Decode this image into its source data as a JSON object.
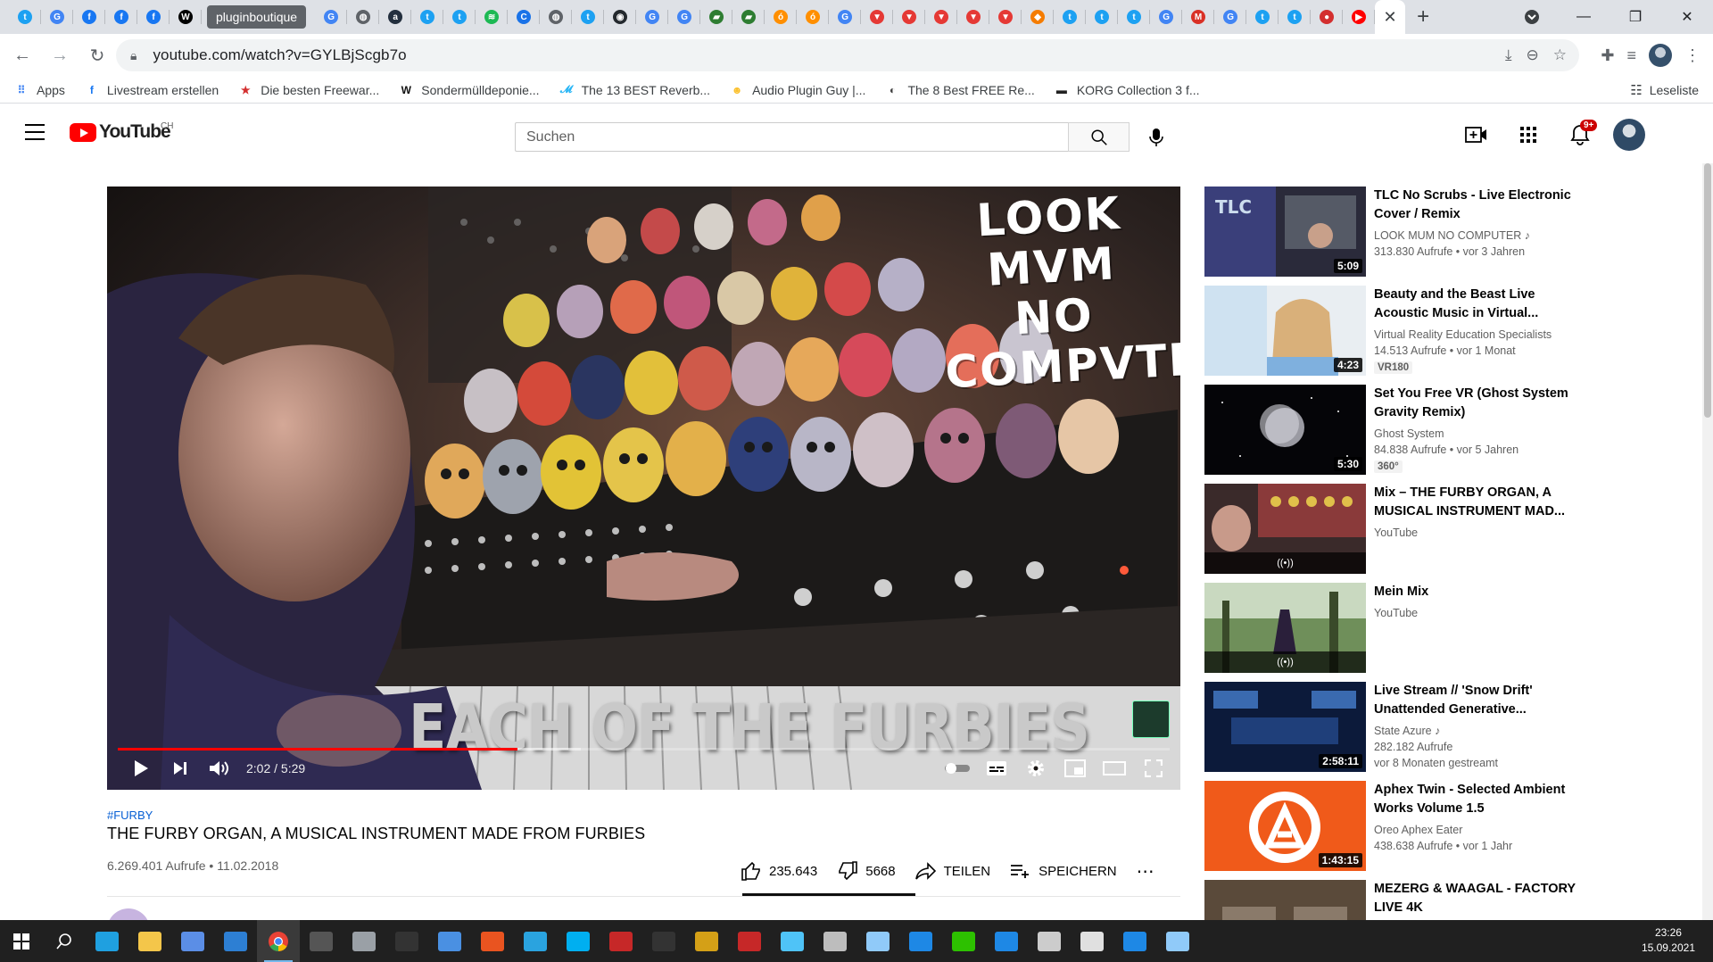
{
  "browser": {
    "tabs": [
      {
        "icon": "twitter-icon",
        "color": "#1da1f2",
        "glyph": "t"
      },
      {
        "icon": "google-icon",
        "color": "#4285f4",
        "glyph": "G"
      },
      {
        "icon": "facebook-icon",
        "color": "#1877f2",
        "glyph": "f"
      },
      {
        "icon": "facebook-icon",
        "color": "#1877f2",
        "glyph": "f"
      },
      {
        "icon": "facebook-icon",
        "color": "#1877f2",
        "glyph": "f"
      },
      {
        "icon": "wikipedia-icon",
        "color": "#000000",
        "glyph": "W"
      }
    ],
    "highlight_tab_label": "pluginboutique",
    "tabs_after": [
      {
        "icon": "google-icon",
        "color": "#4285f4",
        "glyph": "G"
      },
      {
        "icon": "globe-icon",
        "color": "#5f6368",
        "glyph": "◍"
      },
      {
        "icon": "amazon-icon",
        "color": "#232f3e",
        "glyph": "a"
      },
      {
        "icon": "twitter-icon",
        "color": "#1da1f2",
        "glyph": "t"
      },
      {
        "icon": "twitter-icon",
        "color": "#1da1f2",
        "glyph": "t"
      },
      {
        "icon": "spotify-icon",
        "color": "#1db954",
        "glyph": "≋"
      },
      {
        "icon": "chrome-blue-icon",
        "color": "#1a73e8",
        "glyph": "C"
      },
      {
        "icon": "globe-icon",
        "color": "#5f6368",
        "glyph": "◍"
      },
      {
        "icon": "twitter-square-icon",
        "color": "#1da1f2",
        "glyph": "t"
      },
      {
        "icon": "github-icon",
        "color": "#24292e",
        "glyph": "◉"
      },
      {
        "icon": "google-icon",
        "color": "#4285f4",
        "glyph": "G"
      },
      {
        "icon": "google-icon",
        "color": "#4285f4",
        "glyph": "G"
      },
      {
        "icon": "plugin-icon",
        "color": "#2e7d32",
        "glyph": "▰"
      },
      {
        "icon": "plugin-icon",
        "color": "#2e7d32",
        "glyph": "▰"
      },
      {
        "icon": "audio-icon",
        "color": "#ff8f00",
        "glyph": "ó"
      },
      {
        "icon": "audio-icon",
        "color": "#ff8f00",
        "glyph": "ó"
      },
      {
        "icon": "google-icon",
        "color": "#4285f4",
        "glyph": "G"
      },
      {
        "icon": "plugin-boutique-icon",
        "color": "#e53935",
        "glyph": "▼"
      },
      {
        "icon": "plugin-boutique-icon",
        "color": "#e53935",
        "glyph": "▼"
      },
      {
        "icon": "plugin-boutique-icon",
        "color": "#e53935",
        "glyph": "▼"
      },
      {
        "icon": "plugin-boutique-icon",
        "color": "#e53935",
        "glyph": "▼"
      },
      {
        "icon": "plugin-boutique-icon",
        "color": "#e53935",
        "glyph": "▼"
      },
      {
        "icon": "shield-icon",
        "color": "#f57c00",
        "glyph": "◆"
      },
      {
        "icon": "twitter-square-icon",
        "color": "#1da1f2",
        "glyph": "t"
      },
      {
        "icon": "twitter-icon",
        "color": "#1da1f2",
        "glyph": "t"
      },
      {
        "icon": "twitter-icon",
        "color": "#1da1f2",
        "glyph": "t"
      },
      {
        "icon": "google-icon",
        "color": "#4285f4",
        "glyph": "G"
      },
      {
        "icon": "gmail-icon",
        "color": "#d93025",
        "glyph": "M"
      },
      {
        "icon": "google-icon",
        "color": "#4285f4",
        "glyph": "G"
      },
      {
        "icon": "twitter-icon",
        "color": "#1da1f2",
        "glyph": "t"
      },
      {
        "icon": "twitter-icon",
        "color": "#1da1f2",
        "glyph": "t"
      },
      {
        "icon": "red-circle-icon",
        "color": "#d32f2f",
        "glyph": "●"
      },
      {
        "icon": "youtube-icon",
        "color": "#ff0000",
        "glyph": "▶"
      }
    ],
    "url": "youtube.com/watch?v=GYLBjScgb7o",
    "bookmarks": [
      {
        "label": "Apps",
        "icon": "apps-grid-icon",
        "color": "#4285f4",
        "glyph": "⠿"
      },
      {
        "label": "Livestream erstellen",
        "icon": "facebook-icon",
        "color": "#1877f2",
        "glyph": "f"
      },
      {
        "label": "Die besten Freewar...",
        "icon": "star-icon",
        "color": "#d32f2f",
        "glyph": "★"
      },
      {
        "label": "Sondermülldeponie...",
        "icon": "wordpress-icon",
        "color": "#111111",
        "glyph": "W"
      },
      {
        "label": "The 13 BEST Reverb...",
        "icon": "music-icon",
        "color": "#29b6f6",
        "glyph": "𝓜"
      },
      {
        "label": "Audio Plugin Guy |...",
        "icon": "plugin-guy-icon",
        "color": "#fbc02d",
        "glyph": "☻"
      },
      {
        "label": "The 8 Best FREE Re...",
        "icon": "moon-icon",
        "color": "#424242",
        "glyph": "◐"
      },
      {
        "label": "KORG Collection 3 f...",
        "icon": "korg-icon",
        "color": "#212121",
        "glyph": "▬"
      }
    ],
    "reading_list": "Leseliste"
  },
  "youtube": {
    "country": "CH",
    "search_placeholder": "Suchen",
    "notifications": "9+"
  },
  "player": {
    "time": "2:02 / 5:29",
    "progress": 0.38,
    "buffered": 0.44,
    "overlay_title": "LOOK MVM NO COMPVTER",
    "caption": "EACH OF THE FURBIES"
  },
  "video": {
    "hashtag": "#FURBY",
    "title": "THE FURBY ORGAN, A MUSICAL INSTRUMENT MADE FROM FURBIES",
    "meta": "6.269.401 Aufrufe • 11.02.2018",
    "likes": "235.643",
    "dislikes": "5668",
    "share": "TEILEN",
    "save": "SPEICHERN"
  },
  "recommendations": [
    {
      "title": "TLC No Scrubs - Live Electronic Cover / Remix",
      "channel": "LOOK MUM NO COMPUTER ♪",
      "stats": "313.830 Aufrufe • vor 3 Jahren",
      "duration": "5:09",
      "badge": "",
      "live_glyph": ""
    },
    {
      "title": "Beauty and the Beast Live Acoustic Music in Virtual...",
      "channel": "Virtual Reality Education Specialists",
      "stats": "14.513 Aufrufe • vor 1 Monat",
      "duration": "4:23",
      "badge": "VR180",
      "live_glyph": ""
    },
    {
      "title": "Set You Free VR (Ghost System Gravity Remix)",
      "channel": "Ghost System",
      "stats": "84.838 Aufrufe • vor 5 Jahren",
      "duration": "5:30",
      "badge": "360°",
      "live_glyph": ""
    },
    {
      "title": "Mix – THE FURBY ORGAN, A MUSICAL INSTRUMENT MAD...",
      "channel": "YouTube",
      "stats": "",
      "duration": "",
      "badge": "",
      "live_glyph": "((•))"
    },
    {
      "title": "Mein Mix",
      "channel": "YouTube",
      "stats": "",
      "duration": "",
      "badge": "",
      "live_glyph": "((•))"
    },
    {
      "title": "Live Stream // 'Snow Drift' Unattended Generative...",
      "channel": "State Azure ♪",
      "stats": "282.182 Aufrufe\nvor 8 Monaten gestreamt",
      "duration": "2:58:11",
      "badge": "",
      "live_glyph": ""
    },
    {
      "title": "Aphex Twin - Selected Ambient Works Volume 1.5",
      "channel": "Oreo Aphex Eater",
      "stats": "438.638 Aufrufe • vor 1 Jahr",
      "duration": "1:43:15",
      "badge": "",
      "live_glyph": ""
    },
    {
      "title": "MEZERG & WAAGAL - FACTORY LIVE 4K",
      "channel": "",
      "stats": "",
      "duration": "",
      "badge": "",
      "live_glyph": ""
    }
  ],
  "taskbar": {
    "apps": [
      {
        "icon": "windows-start-icon",
        "color": "#ffffff"
      },
      {
        "icon": "search-icon",
        "color": "#ffffff"
      },
      {
        "icon": "edge-icon",
        "color": "#1fa0e0"
      },
      {
        "icon": "file-explorer-icon",
        "color": "#f4c64a"
      },
      {
        "icon": "store-icon",
        "color": "#5b8ee6"
      },
      {
        "icon": "mail-icon",
        "color": "#2d7fd3"
      },
      {
        "icon": "chrome-icon",
        "color": "#e94235"
      },
      {
        "icon": "app-dark-icon",
        "color": "#555555"
      },
      {
        "icon": "app-diamond-icon",
        "color": "#9aa0a6"
      },
      {
        "icon": "ableton-live-icon",
        "color": "#333333"
      },
      {
        "icon": "sync-icon",
        "color": "#4a90e2"
      },
      {
        "icon": "ubuntu-icon",
        "color": "#e95420"
      },
      {
        "icon": "telegram-icon",
        "color": "#2aa3df"
      },
      {
        "icon": "skype-icon",
        "color": "#00aff0"
      },
      {
        "icon": "app-red-icon",
        "color": "#c62828"
      },
      {
        "icon": "kali-icon",
        "color": "#333333"
      },
      {
        "icon": "x-app-icon",
        "color": "#d4a017"
      },
      {
        "icon": "voicemeeter-icon",
        "color": "#c62828"
      },
      {
        "icon": "help-icon",
        "color": "#4fc3f7"
      },
      {
        "icon": "vm-icon",
        "color": "#bdbdbd"
      },
      {
        "icon": "cube-icon",
        "color": "#90caf9"
      },
      {
        "icon": "camera-icon",
        "color": "#1e88e5"
      },
      {
        "icon": "wechat-icon",
        "color": "#2dc100"
      },
      {
        "icon": "window-icon",
        "color": "#1e88e5"
      },
      {
        "icon": "terminal-icon",
        "color": "#cccccc"
      },
      {
        "icon": "notepad-icon",
        "color": "#e0e0e0"
      },
      {
        "icon": "photos-icon",
        "color": "#1e88e5"
      },
      {
        "icon": "tablet-icon",
        "color": "#90caf9"
      }
    ],
    "time": "23:26",
    "date": "15.09.2021"
  }
}
